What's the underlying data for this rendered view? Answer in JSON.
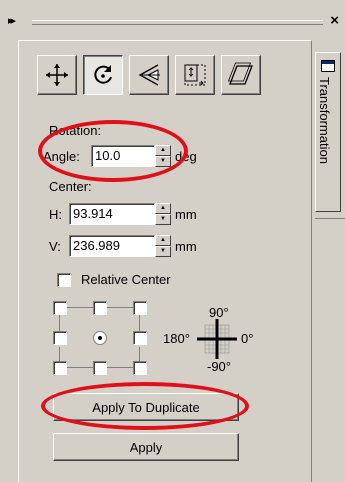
{
  "docker": {
    "close_glyph": "×",
    "grip_glyph": "▸▸",
    "tab_label": "Transformation"
  },
  "toolbar": {
    "buttons": [
      {
        "name": "position",
        "icon": "move-arrows-icon"
      },
      {
        "name": "rotate",
        "icon": "rotate-icon"
      },
      {
        "name": "scale-mirror",
        "icon": "mirror-icon"
      },
      {
        "name": "size",
        "icon": "size-icon"
      },
      {
        "name": "skew",
        "icon": "skew-icon"
      }
    ],
    "active": "rotate"
  },
  "rotation": {
    "heading": "Rotation:",
    "angle_label": "Angle:",
    "angle_value": "10.0",
    "angle_unit": "deg"
  },
  "center": {
    "heading": "Center:",
    "h_label": "H:",
    "h_value": "93.914",
    "h_unit": "mm",
    "v_label": "V:",
    "v_value": "236.989",
    "v_unit": "mm",
    "relative_label": "Relative Center",
    "relative_checked": false
  },
  "dial": {
    "top": "90°",
    "left": "180°",
    "right": "0°",
    "bottom": "-90°"
  },
  "buttons": {
    "apply_to_duplicate": "Apply To Duplicate",
    "apply": "Apply"
  },
  "annotation_color": "#e0101a"
}
